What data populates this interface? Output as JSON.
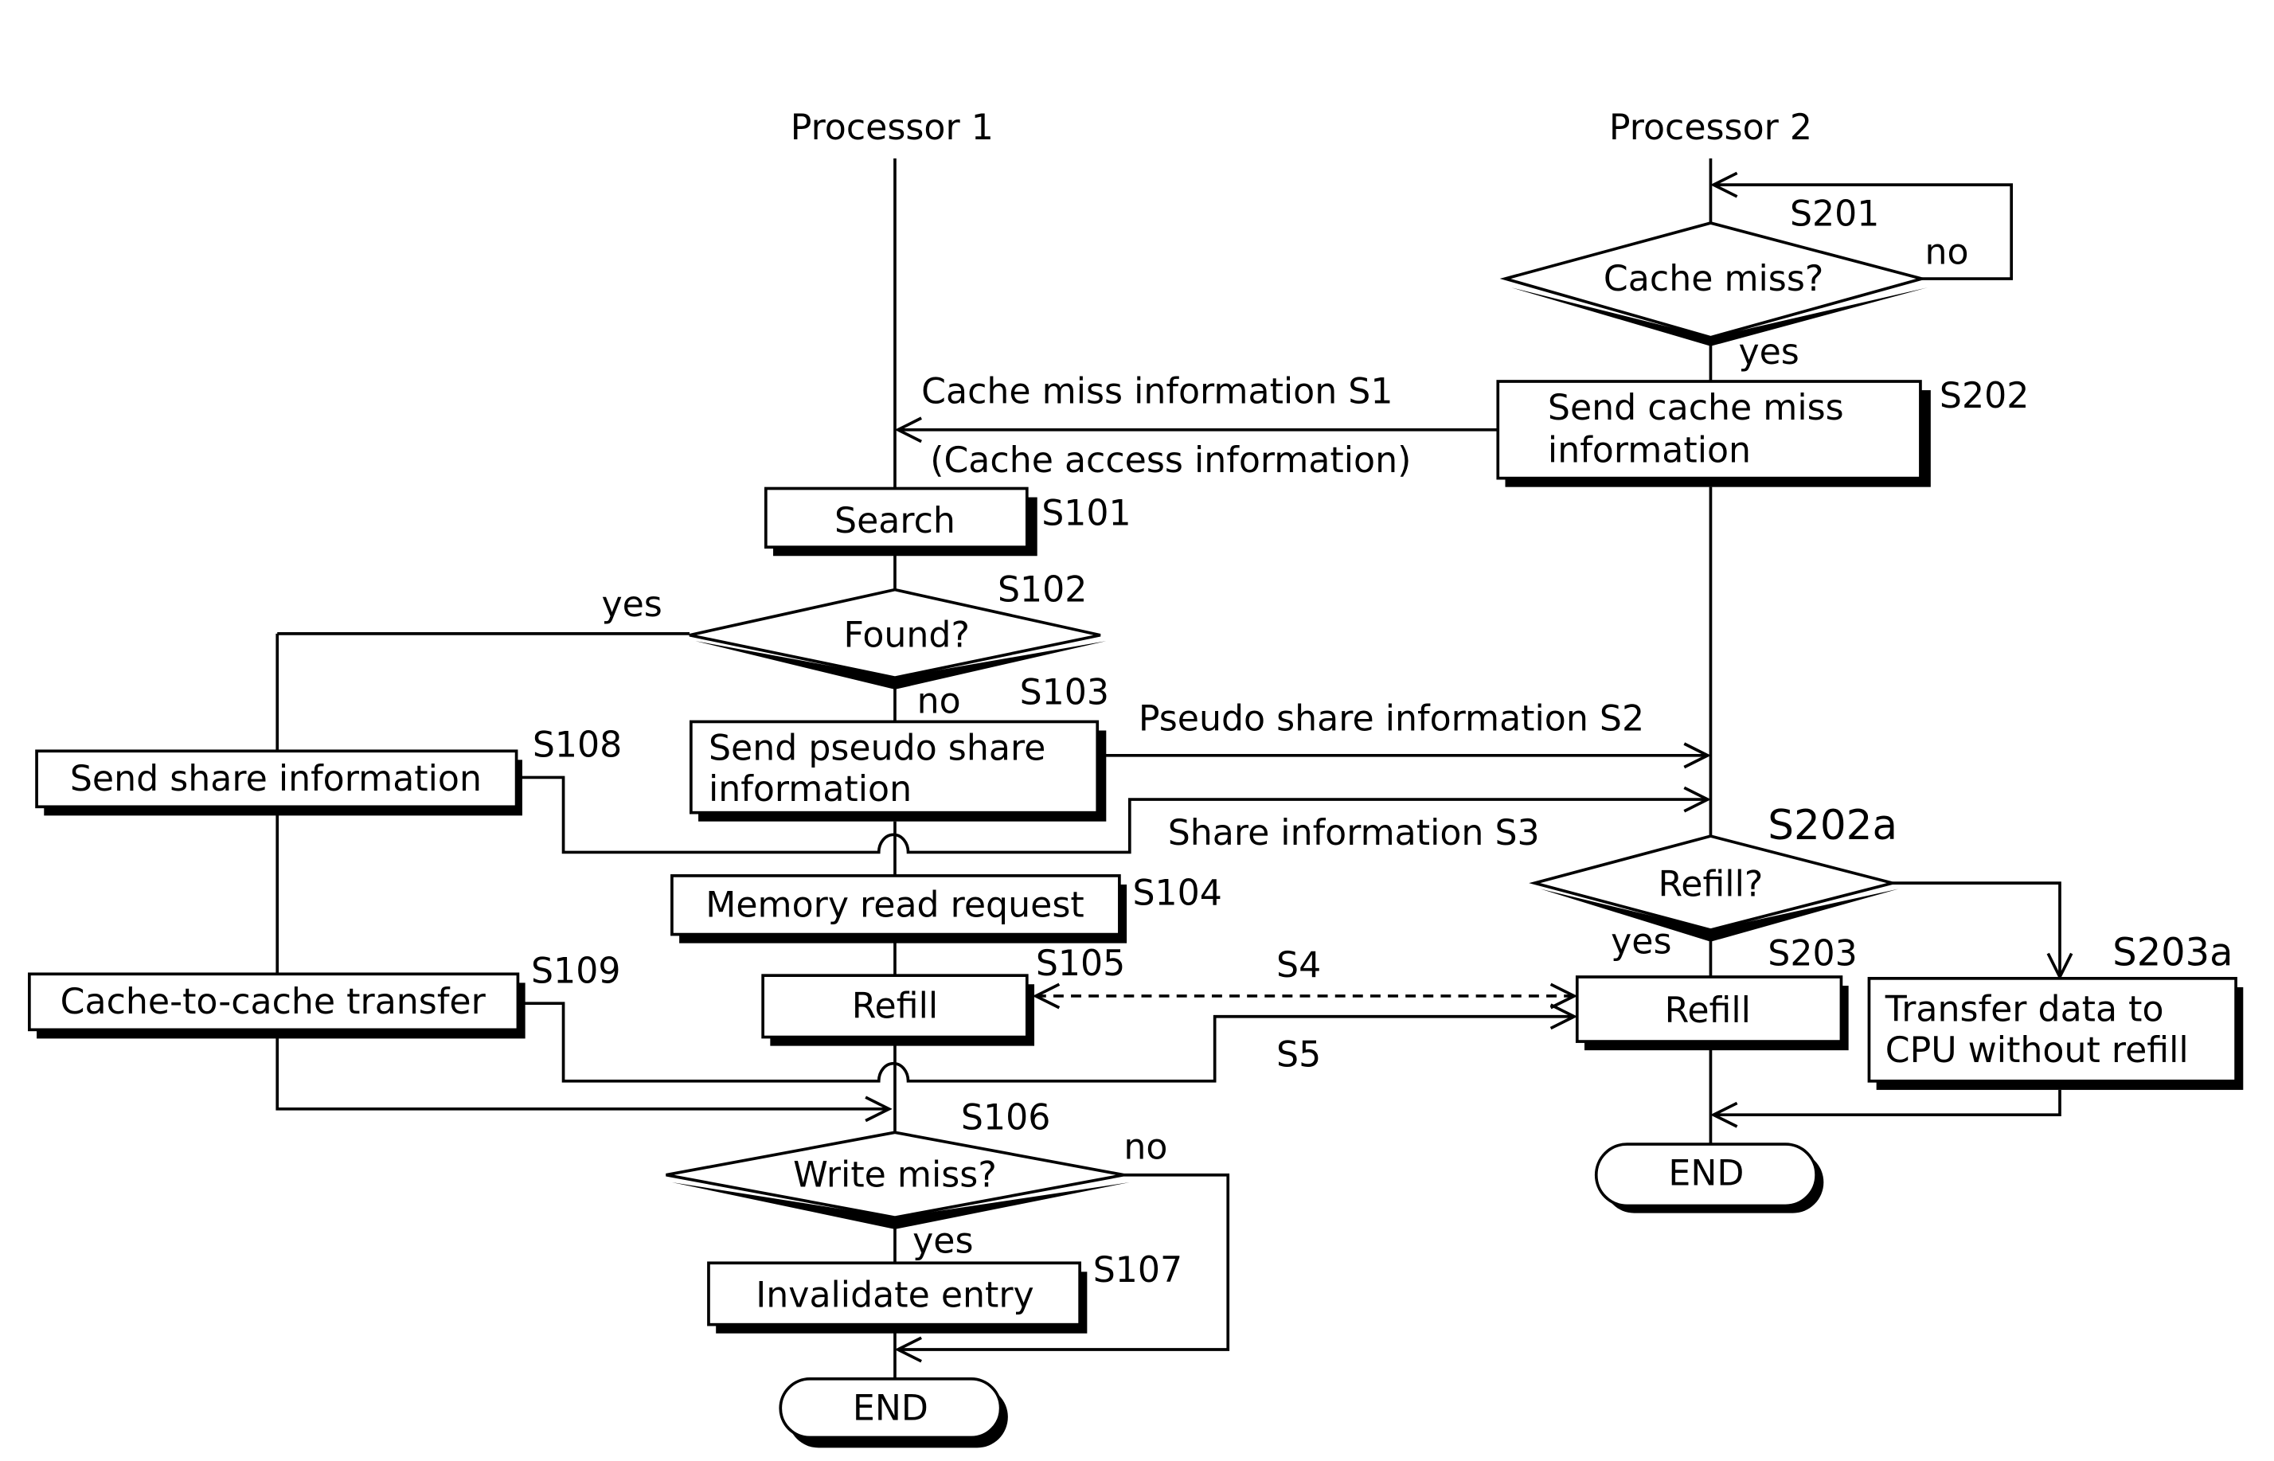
{
  "lanes": {
    "processor1": "Processor 1",
    "processor2": "Processor 2"
  },
  "steps": {
    "S201": {
      "id": "S201",
      "label": "Cache miss?",
      "yes": "yes",
      "no": "no"
    },
    "S202": {
      "id": "S202",
      "line1": "Send cache miss",
      "line2": "information"
    },
    "S101": {
      "id": "S101",
      "label": "Search"
    },
    "S102": {
      "id": "S102",
      "label": "Found?",
      "yes": "yes",
      "no": "no"
    },
    "S103": {
      "id": "S103",
      "line1": "Send pseudo share",
      "line2": "information"
    },
    "S104": {
      "id": "S104",
      "label": "Memory read request"
    },
    "S105": {
      "id": "S105",
      "label": "Refill"
    },
    "S106": {
      "id": "S106",
      "label": "Write miss?",
      "yes": "yes",
      "no": "no"
    },
    "S107": {
      "id": "S107",
      "label": "Invalidate entry"
    },
    "S108": {
      "id": "S108",
      "label": "Send share information"
    },
    "S109": {
      "id": "S109",
      "label": "Cache-to-cache transfer"
    },
    "S202a": {
      "id": "S202a",
      "label": "Refill?",
      "yes": "yes"
    },
    "S203": {
      "id": "S203",
      "label": "Refill"
    },
    "S203a": {
      "id": "S203a",
      "line1": "Transfer data to",
      "line2": "CPU without refill"
    },
    "end1": {
      "label": "END"
    },
    "end2": {
      "label": "END"
    }
  },
  "signals": {
    "S1": {
      "line1": "Cache miss information S1",
      "line2": "(Cache access information)"
    },
    "S2": {
      "label": "Pseudo share information S2"
    },
    "S3": {
      "label": "Share information S3"
    },
    "S4": {
      "label": "S4"
    },
    "S5": {
      "label": "S5"
    }
  }
}
